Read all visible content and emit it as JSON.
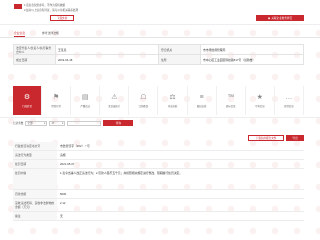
{
  "top": {
    "warning_label": "提示",
    "line1": "1.该信息仅供参考，不作为任何依据",
    "line2": "2.如对以上信息有异议，请与公示机关联系处理",
    "download_button": "下载文书",
    "red_button": "关联企业财务状况"
  },
  "tabs": [
    {
      "label": "企业信息"
    },
    {
      "label": "参考法律法规"
    }
  ],
  "info": {
    "rows": [
      {
        "l1": "法定代表人/负责人/执行事务合伙人",
        "v1": "王某某",
        "l2": "登记机关",
        "v2": "市市场监督管理局"
      },
      {
        "l1": "成立日期",
        "v1": "2019-04-18",
        "l2": "住所",
        "v2": "市中心区工业园区科技路517号（试验楼）"
      }
    ]
  },
  "icons": [
    {
      "label": "行政处罚",
      "glyph": "⚙"
    },
    {
      "label": "经营异常",
      "glyph": "⚑"
    },
    {
      "label": "严重违法",
      "glyph": "▤"
    },
    {
      "label": "失信被执行",
      "glyph": "⚠"
    },
    {
      "label": "注销备案",
      "glyph": "☖"
    },
    {
      "label": "司法协助",
      "glyph": "⚖"
    },
    {
      "label": "股权出质",
      "glyph": "≡"
    },
    {
      "label": "商标信息",
      "glyph": "™"
    },
    {
      "label": "专利信息",
      "glyph": "★"
    },
    {
      "label": "其他信息",
      "glyph": "…"
    }
  ],
  "filter": {
    "label1": "记录条数",
    "select1": "全部",
    "select2": "17",
    "search": "查询"
  },
  "actions": {
    "btn1": "下载信用报告文件",
    "btn2": "导出"
  },
  "details": [
    {
      "label": "行政处罚决定书文号",
      "value": "市监管罚字〔202〕㇀号"
    },
    {
      "label": "违法行为类型",
      "value": "违规"
    },
    {
      "label": "处罚日期",
      "value": "2021-05-07"
    },
    {
      "label": "处罚内容",
      "value": "1.责令当事人改正违法行为；2.罚款人民币五千元；并按照相关规定进行整改，限期履行处罚决定。"
    },
    {
      "label": "罚款金额",
      "value": "5000"
    },
    {
      "label": "没收违法所得、没收非法财物的金额（万元）",
      "value": "2.12"
    },
    {
      "label": "备注",
      "value": "无"
    }
  ]
}
